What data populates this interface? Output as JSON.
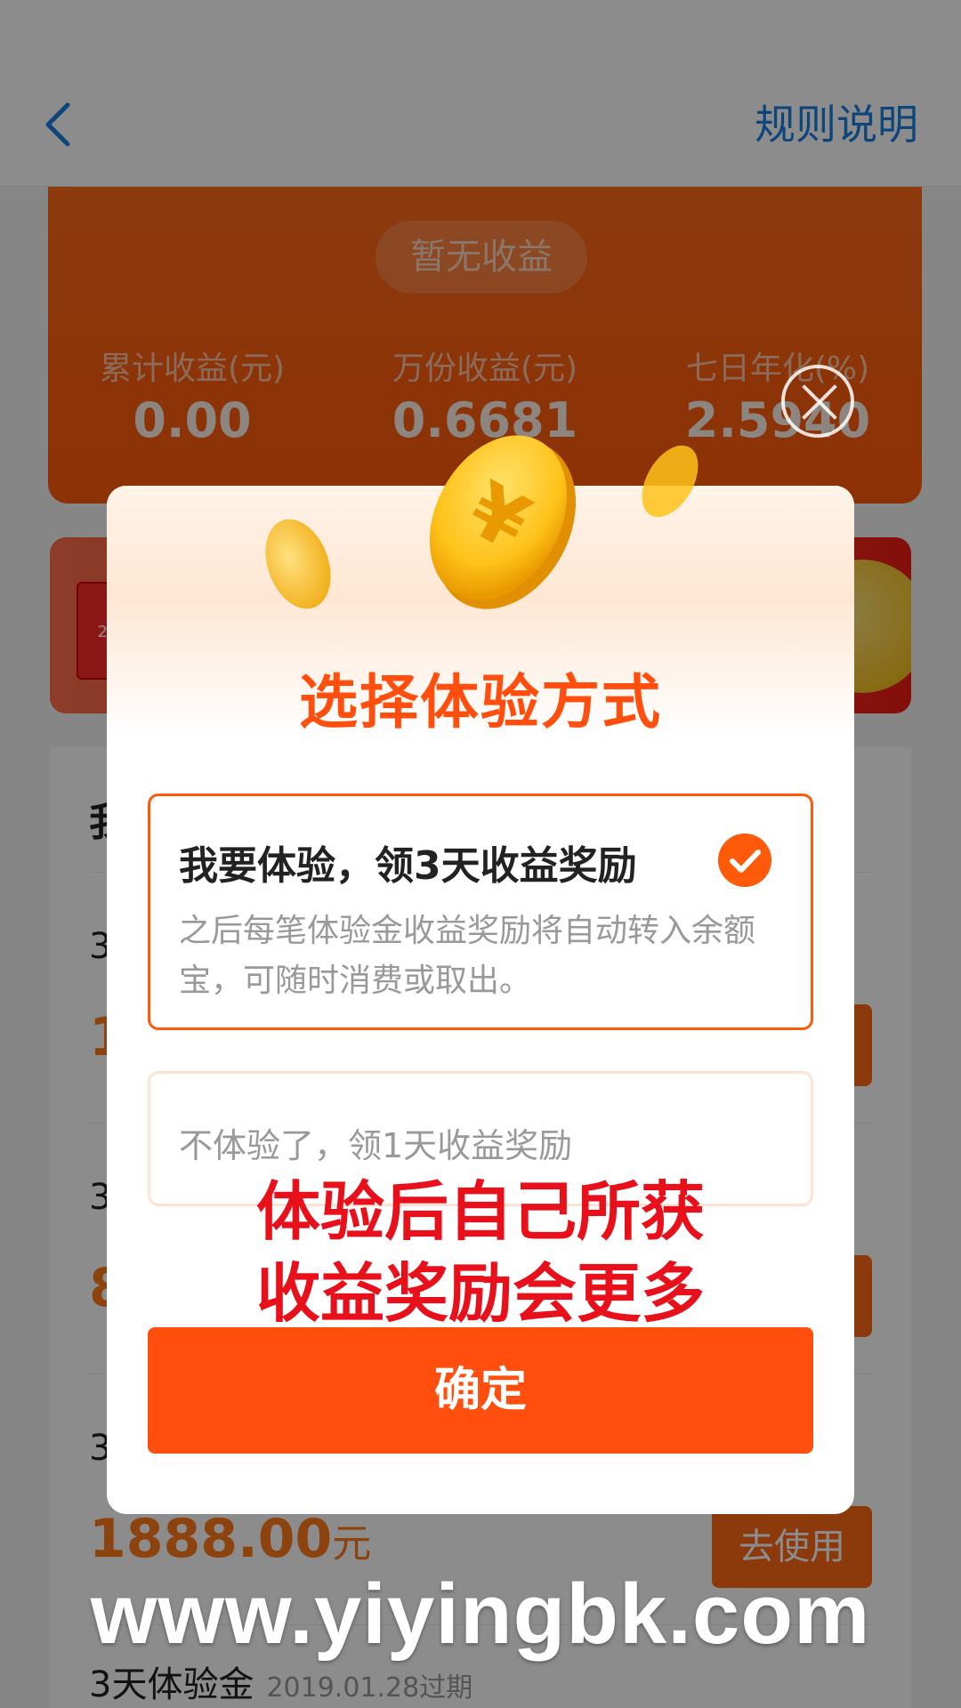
{
  "nav": {
    "back_icon": "chevron-left-icon",
    "rules_label": "规则说明"
  },
  "earnings": {
    "no_earnings": "暂无收益",
    "stats": [
      {
        "label": "累计收益(元)",
        "value": "0.00"
      },
      {
        "label": "万份收益(元)",
        "value": "0.6681"
      },
      {
        "label": "七日年化(%)",
        "value": "2.5940"
      }
    ]
  },
  "banner": {
    "coupon_text": "28"
  },
  "list": {
    "title": "我",
    "rows": [
      {
        "name": "3",
        "amount": "1",
        "unit": "",
        "action": ""
      },
      {
        "name": "3",
        "amount": "8",
        "unit": "",
        "action": ""
      },
      {
        "name": "3",
        "amount": "1888.00",
        "unit": "元",
        "action": "去使用"
      },
      {
        "name": "3天体验金",
        "expire": "2019.01.28过期"
      }
    ]
  },
  "modal": {
    "title": "选择体验方式",
    "option_selected": {
      "title": "我要体验，领3天收益奖励",
      "desc": "之后每笔体验金收益奖励将自动转入余额宝，可随时消费或取出。"
    },
    "option_other": {
      "title": "不体验了，领1天收益奖励"
    },
    "note_line1": "体验后自己所获",
    "note_line2": "收益奖励会更多",
    "confirm_label": "确定"
  },
  "watermark": "www.yiyingbk.com",
  "colors": {
    "accent": "#ff4e0d",
    "link": "#1a7fe0",
    "note_red": "#e8101a"
  }
}
